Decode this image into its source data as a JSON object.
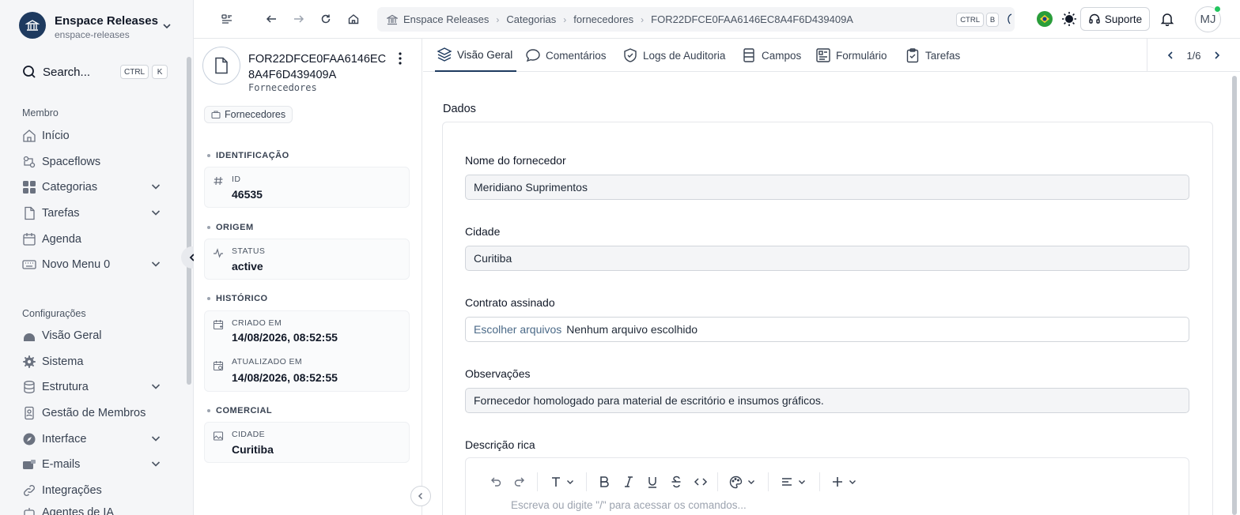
{
  "org": {
    "name": "Enspace Releases",
    "slug": "enspace-releases"
  },
  "search": {
    "label": "Search...",
    "kbd1": "CTRL",
    "kbd2": "K"
  },
  "sidebar": {
    "member_section": "Membro",
    "member_items": [
      {
        "label": "Início",
        "icon": "home-icon"
      },
      {
        "label": "Spaceflows",
        "icon": "flow-icon"
      },
      {
        "label": "Categorias",
        "icon": "grid-icon",
        "expandable": true
      },
      {
        "label": "Tarefas",
        "icon": "file-icon",
        "expandable": true
      },
      {
        "label": "Agenda",
        "icon": "calendar-icon"
      },
      {
        "label": "Novo Menu 0",
        "icon": "keyboard-icon",
        "expandable": true
      }
    ],
    "config_section": "Configurações",
    "config_items": [
      {
        "label": "Visão Geral",
        "icon": "dashboard-icon"
      },
      {
        "label": "Sistema",
        "icon": "gear-icon"
      },
      {
        "label": "Estrutura",
        "icon": "database-icon",
        "expandable": true
      },
      {
        "label": "Gestão de Membros",
        "icon": "badge-icon"
      },
      {
        "label": "Interface",
        "icon": "compass-icon",
        "expandable": true
      },
      {
        "label": "E-mails",
        "icon": "mail-icon",
        "expandable": true
      },
      {
        "label": "Integrações",
        "icon": "link-icon"
      },
      {
        "label": "Agentes de IA",
        "icon": "robot-icon"
      }
    ]
  },
  "breadcrumb": {
    "items": [
      "Enspace Releases",
      "Categorias",
      "fornecedores",
      "FOR22DFCE0FAA6146EC8A4F6D439409A"
    ],
    "kbd1": "CTRL",
    "kbd2": "B"
  },
  "topbar": {
    "support_label": "Suporte",
    "avatar_initials": "MJ"
  },
  "record": {
    "title": "FOR22DFCE0FAA6146EC8A4F6D439409A",
    "subtitle": "Fornecedores",
    "tag": "Fornecedores",
    "groups": {
      "identificacao": "IDENTIFICAÇÃO",
      "origem": "ORIGEM",
      "historico": "HISTÓRICO",
      "comercial": "COMERCIAL"
    },
    "id_key": "ID",
    "id_value": "46535",
    "status_key": "STATUS",
    "status_value": "active",
    "created_key": "CRIADO EM",
    "created_value": "14/08/2026, 08:52:55",
    "updated_key": "ATUALIZADO EM",
    "updated_value": "14/08/2026, 08:52:55",
    "city_key": "CIDADE",
    "city_value": "Curitiba"
  },
  "tabs": [
    {
      "label": "Visão Geral",
      "active": true
    },
    {
      "label": "Comentários"
    },
    {
      "label": "Logs de Auditoria"
    },
    {
      "label": "Campos"
    },
    {
      "label": "Formulário"
    },
    {
      "label": "Tarefas"
    }
  ],
  "pager": {
    "text": "1/6"
  },
  "form": {
    "section_title": "Dados",
    "fields": {
      "nome_label": "Nome do fornecedor",
      "nome_value": "Meridiano Suprimentos",
      "cidade_label": "Cidade",
      "cidade_value": "Curitiba",
      "contrato_label": "Contrato assinado",
      "contrato_button": "Escolher arquivos",
      "contrato_status": "Nenhum arquivo escolhido",
      "obs_label": "Observações",
      "obs_value": "Fornecedor homologado para material de escritório e insumos gráficos.",
      "desc_label": "Descrição rica",
      "desc_placeholder": "Escreva ou digite \"/\" para acessar os comandos..."
    }
  }
}
